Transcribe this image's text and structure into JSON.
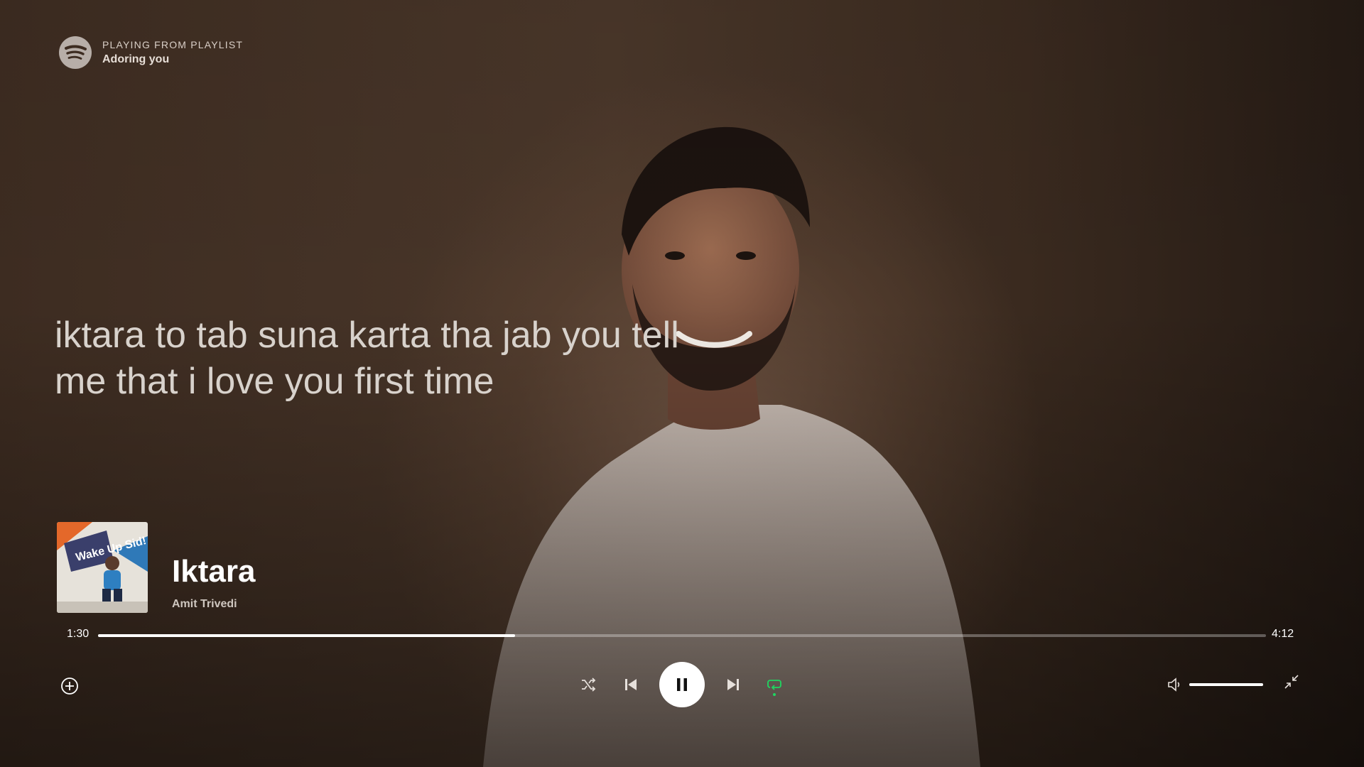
{
  "context": {
    "label": "PLAYING FROM PLAYLIST",
    "playlist_name": "Adoring you"
  },
  "lyrics": {
    "current_line": "iktara to tab suna karta tha jab you tell me that i love you first time"
  },
  "now_playing": {
    "title": "Iktara",
    "artist": "Amit Trivedi",
    "cover_alt": "Wake Up Sid album cover",
    "cover_text": "Wake Up Sid!"
  },
  "playback": {
    "elapsed": "1:30",
    "total": "4:12",
    "progress_fraction": 0.357,
    "is_playing": true,
    "repeat_enabled": true
  },
  "volume": {
    "level_fraction": 1.0
  },
  "icons": {
    "logo": "spotify-logo",
    "add": "plus-circle-icon",
    "shuffle": "shuffle-icon",
    "previous": "skip-previous-icon",
    "pause": "pause-icon",
    "next": "skip-next-icon",
    "repeat": "repeat-icon",
    "volume": "speaker-icon",
    "exit_fullscreen": "minimize-icon"
  },
  "colors": {
    "accent": "#1ed760",
    "background": "#3a2a1f",
    "text": "#ffffff"
  }
}
